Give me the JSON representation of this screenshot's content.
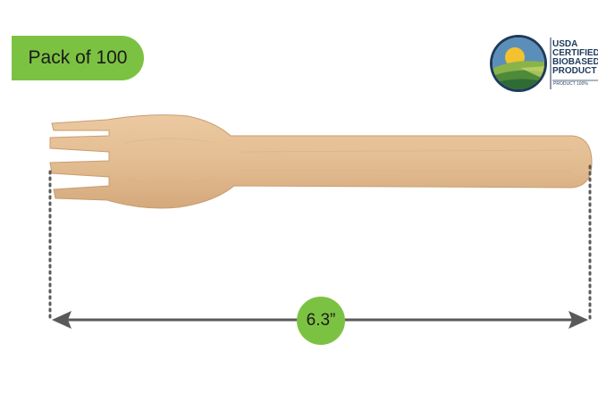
{
  "badge": {
    "pack_text": "Pack of 100"
  },
  "certification": {
    "line1": "USDA",
    "line2": "CERTIFIED",
    "line3": "BIOBASED",
    "line4": "PRODUCT",
    "sub": "PRODUCT 100%"
  },
  "measurement": {
    "length_label": "6.3”"
  },
  "colors": {
    "accent_green": "#7cc242",
    "wood": "#e3bd92",
    "wood_shadow": "#cfa477",
    "dimension_line": "#5a5a5a",
    "usda_blue": "#1f3a5c"
  },
  "icons": [
    "usda-biobased-seal-icon",
    "double-arrow-icon"
  ]
}
